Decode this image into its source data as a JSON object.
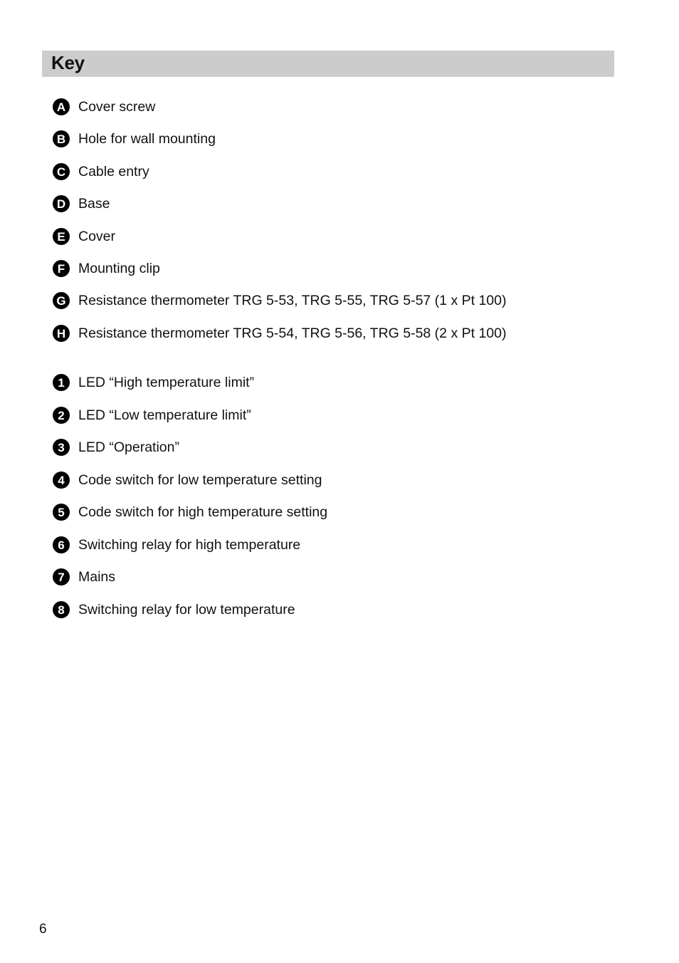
{
  "section": {
    "title": "Key"
  },
  "letter_items": [
    {
      "marker": "A",
      "label": "Cover screw"
    },
    {
      "marker": "B",
      "label": "Hole for wall mounting"
    },
    {
      "marker": "C",
      "label": "Cable entry"
    },
    {
      "marker": "D",
      "label": "Base"
    },
    {
      "marker": "E",
      "label": "Cover"
    },
    {
      "marker": "F",
      "label": "Mounting clip"
    },
    {
      "marker": "G",
      "label": "Resistance thermometer TRG 5-53, TRG 5-55, TRG 5-57 (1 x Pt 100)"
    },
    {
      "marker": "H",
      "label": "Resistance thermometer TRG 5-54, TRG 5-56, TRG 5-58 (2 x Pt 100)"
    }
  ],
  "number_items": [
    {
      "marker": "1",
      "label": "LED “High temperature limit”"
    },
    {
      "marker": "2",
      "label": "LED “Low temperature limit”"
    },
    {
      "marker": "3",
      "label": "LED “Operation”"
    },
    {
      "marker": "4",
      "label": "Code switch for low temperature setting"
    },
    {
      "marker": "5",
      "label": "Code switch for high temperature setting"
    },
    {
      "marker": "6",
      "label": "Switching relay for high temperature"
    },
    {
      "marker": "7",
      "label": "Mains"
    },
    {
      "marker": "8",
      "label": "Switching relay for low temperature"
    }
  ],
  "page_number": "6"
}
